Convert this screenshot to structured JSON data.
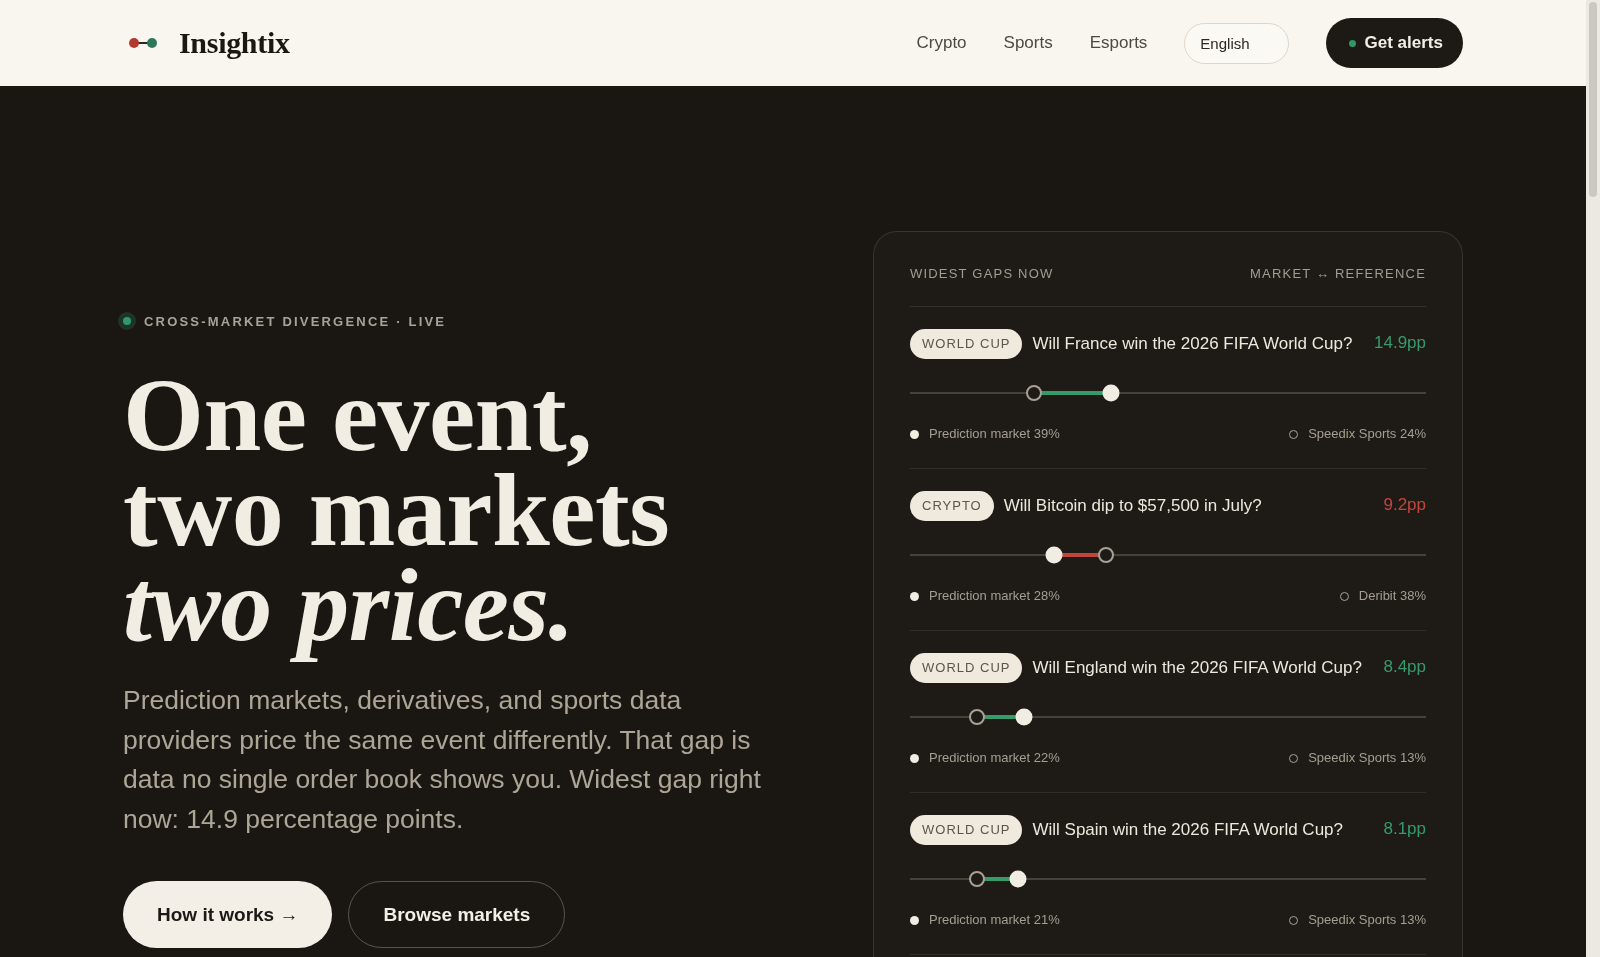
{
  "header": {
    "logo": "Insightix",
    "nav": [
      "Crypto",
      "Sports",
      "Esports"
    ],
    "language": "English",
    "cta": "Get alerts"
  },
  "hero": {
    "eyebrow": "CROSS-MARKET DIVERGENCE · LIVE",
    "headline": "One event, two markets *two prices.*",
    "description": "Prediction markets, derivatives, and sports data providers price the same event differently. That gap is data no single order book shows you. Widest gap right now: 14.9 percentage points.",
    "buttons": [
      {
        "label": "How it works →",
        "kind": "primary"
      },
      {
        "label": "Browse markets",
        "kind": "secondary"
      }
    ]
  },
  "gaps_panel": {
    "title": "WIDEST GAPS NOW",
    "legend_heading": "MARKET ↔ REFERENCE",
    "rows": [
      {
        "tag": "WORLD CUP",
        "question": "Will France win the 2026 FIFA World Cup?",
        "gap": "14.9pp",
        "color": "#379a6b",
        "market": {
          "label": "Prediction market 39%",
          "level": 0.39
        },
        "reference": {
          "label": "Speedix Sports 24%",
          "level": 0.24
        }
      },
      {
        "tag": "CRYPTO",
        "question": "Will Bitcoin dip to $57,500 in July?",
        "gap": "9.2pp",
        "color": "#c2463c",
        "market": {
          "label": "Prediction market 28%",
          "level": 0.28
        },
        "reference": {
          "label": "Deribit 38%",
          "level": 0.38
        }
      },
      {
        "tag": "WORLD CUP",
        "question": "Will England win the 2026 FIFA World Cup?",
        "gap": "8.4pp",
        "color": "#379a6b",
        "market": {
          "label": "Prediction market 22%",
          "level": 0.22
        },
        "reference": {
          "label": "Speedix Sports 13%",
          "level": 0.13
        }
      },
      {
        "tag": "WORLD CUP",
        "question": "Will Spain win the 2026 FIFA World Cup?",
        "gap": "8.1pp",
        "color": "#379a6b",
        "market": {
          "label": "Prediction market 21%",
          "level": 0.21
        },
        "reference": {
          "label": "Speedix Sports 13%",
          "level": 0.13
        }
      }
    ]
  }
}
